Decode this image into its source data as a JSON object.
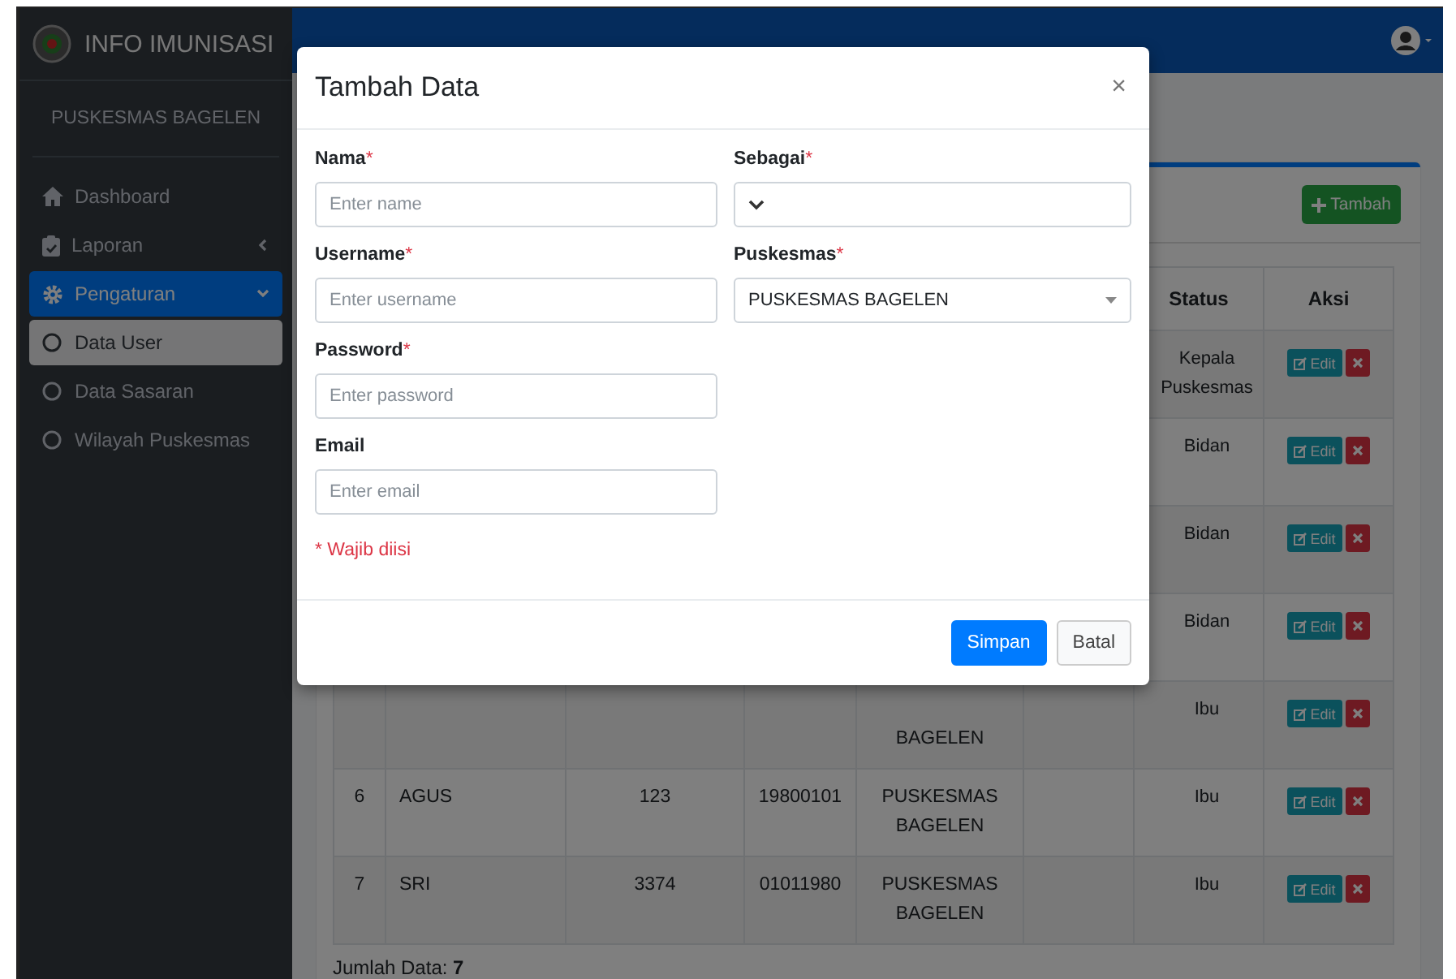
{
  "sidebar": {
    "brand": "INFO IMUNISASI",
    "subtitle": "PUSKESMAS BAGELEN",
    "items": [
      {
        "label": "Dashboard",
        "selected": false
      },
      {
        "label": "Laporan",
        "selected": false,
        "expanded": false
      },
      {
        "label": "Pengaturan",
        "selected": true,
        "expanded": true,
        "children": [
          {
            "label": "Data User",
            "selected": true
          },
          {
            "label": "Data Sasaran",
            "selected": false
          },
          {
            "label": "Wilayah Puskesmas",
            "selected": false
          }
        ]
      }
    ]
  },
  "card": {
    "add_button": "Tambah"
  },
  "table": {
    "columns": [
      {
        "label": "Status"
      },
      {
        "label": "Aksi"
      }
    ],
    "rows": [
      {
        "status": "Kepala Puskesmas",
        "edit": "Edit"
      },
      {
        "status": "Bidan",
        "edit": "Edit"
      },
      {
        "status": "Bidan",
        "edit": "Edit"
      },
      {
        "status": "Bidan",
        "edit": "Edit"
      },
      {
        "column_5_line_2": "BAGELEN",
        "status": "Ibu",
        "edit": "Edit"
      },
      {
        "column_1": "6",
        "column_2": "AGUS",
        "column_3": "123",
        "column_4": "19800101",
        "column_5": "PUSKESMAS BAGELEN",
        "status": "Ibu",
        "edit": "Edit"
      },
      {
        "column_1": "7",
        "column_2": "SRI",
        "column_3": "3374",
        "column_4": "01011980",
        "column_5": "PUSKESMAS BAGELEN",
        "status": "Ibu",
        "edit": "Edit"
      }
    ],
    "total_label": "Jumlah Data:",
    "total": "7"
  },
  "modal": {
    "title": "Tambah Data",
    "close": "×",
    "fields": [
      {
        "kind": "input",
        "label": "Nama",
        "required_mark": "*",
        "placeholder": "Enter name"
      },
      {
        "kind": "select",
        "label": "Sebagai",
        "required_mark": "*"
      },
      {
        "kind": "input",
        "label": "Username",
        "required_mark": "*",
        "placeholder": "Enter username"
      },
      {
        "kind": "combobox",
        "label": "Puskesmas",
        "required_mark": "*",
        "value": "PUSKESMAS BAGELEN"
      },
      {
        "kind": "input",
        "label": "Password",
        "required_mark": "*",
        "placeholder": "Enter password"
      },
      {
        "kind": "empty"
      },
      {
        "kind": "input",
        "label": "Email",
        "placeholder": "Enter email"
      }
    ],
    "required_note": "* Wajib diisi",
    "buttons": [
      {
        "label": "Simpan",
        "kind": "primary"
      },
      {
        "label": "Batal",
        "kind": "secondary"
      }
    ]
  }
}
